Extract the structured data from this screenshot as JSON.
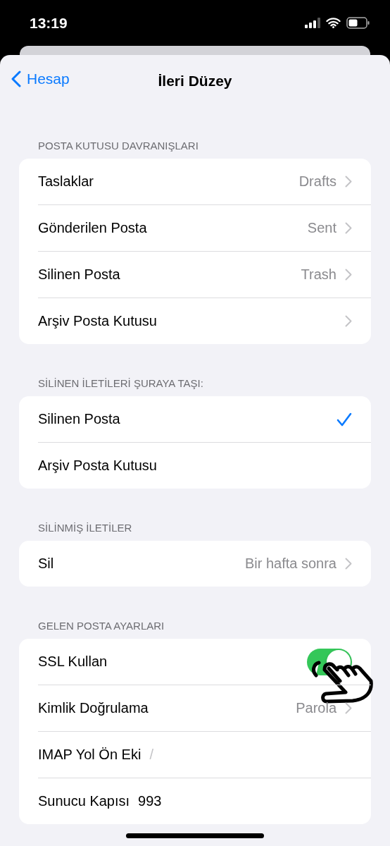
{
  "status_bar": {
    "time": "13:19"
  },
  "nav": {
    "back": "Hesap",
    "title": "İleri Düzey"
  },
  "sections": [
    {
      "header": "POSTA KUTUSU DAVRANIŞLARI",
      "rows": [
        {
          "kind": "link",
          "label": "Taslaklar",
          "value": "Drafts"
        },
        {
          "kind": "link",
          "label": "Gönderilen Posta",
          "value": "Sent"
        },
        {
          "kind": "link",
          "label": "Silinen Posta",
          "value": "Trash"
        },
        {
          "kind": "link",
          "label": "Arşiv Posta Kutusu"
        }
      ]
    },
    {
      "header": "SİLİNEN İLETİLERİ ŞURAYA TAŞI:",
      "rows": [
        {
          "kind": "check",
          "label": "Silinen Posta",
          "selected": true
        },
        {
          "kind": "check",
          "label": "Arşiv Posta Kutusu",
          "selected": false
        }
      ]
    },
    {
      "header": "SİLİNMİŞ İLETİLER",
      "rows": [
        {
          "kind": "link",
          "label": "Sil",
          "value": "Bir hafta sonra"
        }
      ]
    },
    {
      "header": "GELEN POSTA AYARLARI",
      "rows": [
        {
          "kind": "toggle",
          "label": "SSL Kullan",
          "on": true
        },
        {
          "kind": "link",
          "label": "Kimlik Doğrulama",
          "value": "Parola"
        },
        {
          "kind": "field",
          "label": "IMAP Yol Ön Eki",
          "placeholder": "/"
        },
        {
          "kind": "field",
          "label": "Sunucu Kapısı",
          "value": "993"
        }
      ]
    }
  ]
}
